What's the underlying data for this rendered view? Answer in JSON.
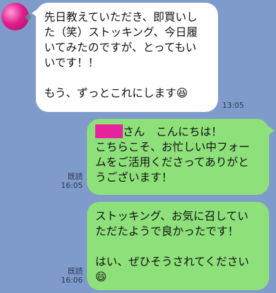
{
  "messages": [
    {
      "direction": "incoming",
      "lines": [
        "先日教えていただき、即買いし",
        "た（笑）ストッキング、今日履",
        "いてみたのですが、とってもい",
        "いです！！",
        "",
        "もう、ずっとこれにします"
      ],
      "emoji": "😆",
      "time": "13:05"
    },
    {
      "direction": "outgoing",
      "first_line_after_name": "さん　こんにちは！",
      "lines": [
        "こちらこそ、お忙しい中フォー",
        "ムをご活用くださってありがと",
        "うございます！"
      ],
      "read_label": "既読",
      "time": "16:05"
    },
    {
      "direction": "outgoing",
      "lines": [
        "ストッキング、お気に召してい",
        "ただたようで良かったです！",
        "",
        "はい、ぜひそうされてください"
      ],
      "emoji": "😄",
      "read_label": "既読",
      "time": "16:06"
    }
  ],
  "colors": {
    "background": "#7f9bcb",
    "incoming_bubble": "#ffffff",
    "outgoing_bubble": "#8de07a",
    "redaction": "#e8239b"
  }
}
